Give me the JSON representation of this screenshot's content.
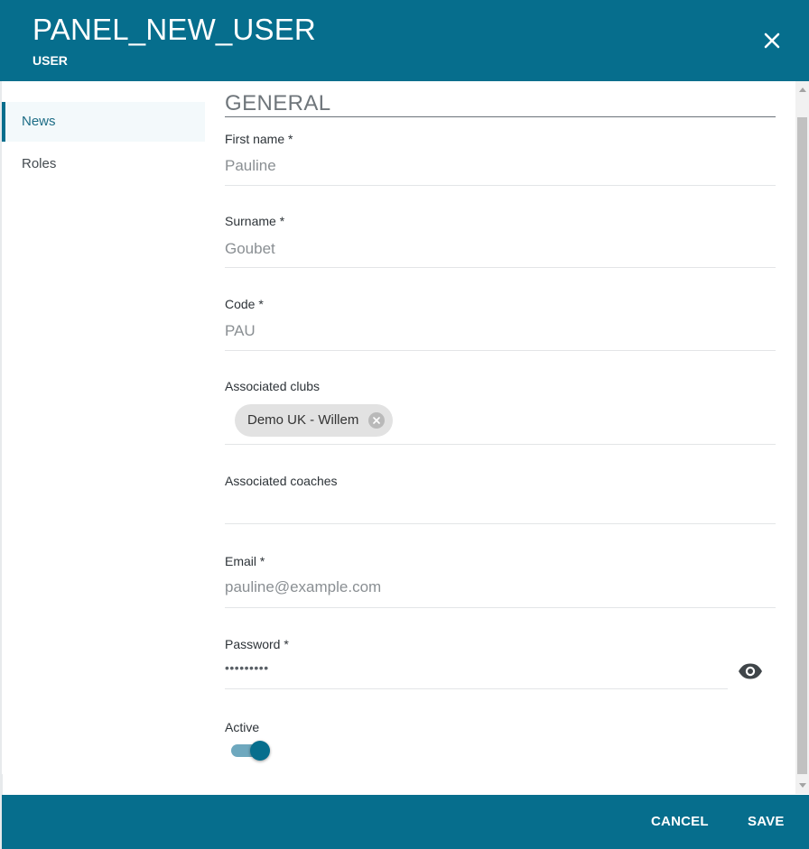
{
  "header": {
    "title": "PANEL_NEW_USER",
    "subtitle": "USER",
    "close_icon": "close-icon"
  },
  "sidebar": {
    "items": [
      {
        "label": "News",
        "active": true
      },
      {
        "label": "Roles",
        "active": false
      }
    ]
  },
  "form": {
    "section_title": "GENERAL",
    "first_name": {
      "label": "First name *",
      "value": "Pauline"
    },
    "surname": {
      "label": "Surname *",
      "value": "Goubet"
    },
    "code": {
      "label": "Code *",
      "value": "PAU"
    },
    "associated_clubs": {
      "label": "Associated clubs",
      "chips": [
        "Demo UK - Willem"
      ]
    },
    "associated_coaches": {
      "label": "Associated coaches",
      "value": ""
    },
    "email": {
      "label": "Email *",
      "value": "pauline@example.com"
    },
    "password": {
      "label": "Password *",
      "value": "•••••••••",
      "toggle_icon": "eye-icon"
    },
    "active": {
      "label": "Active",
      "checked": true
    }
  },
  "footer": {
    "cancel_label": "CANCEL",
    "save_label": "SAVE"
  },
  "colors": {
    "primary": "#066e8d",
    "toggle_track": "#6ea8be"
  }
}
